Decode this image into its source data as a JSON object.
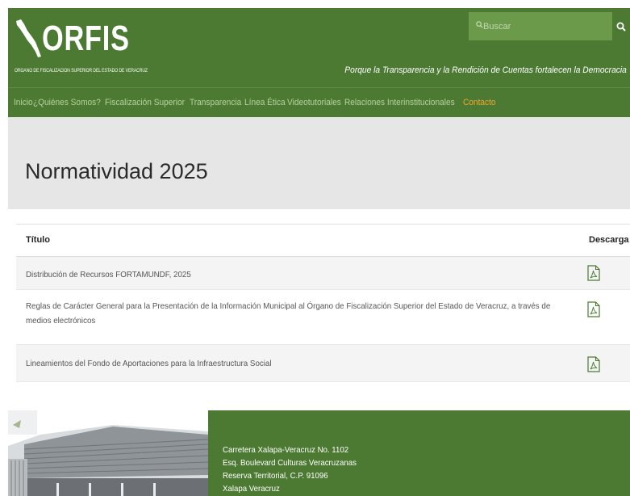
{
  "header": {
    "logo_text": "ORFIS",
    "logo_subtitle": "ÓRGANO DE FISCALIZACIÓN SUPERIOR DEL ESTADO DE VERACRUZ",
    "search_placeholder": "Buscar",
    "tagline": "Porque la Transparencia y la Rendición de Cuentas fortalecen la Democracia",
    "colors": {
      "brand_green": "#4c7a33",
      "search_bg": "#6a9a4a",
      "active_link": "#f0a830"
    }
  },
  "nav": {
    "items": [
      {
        "label": "Inicio",
        "icon": "",
        "active": false
      },
      {
        "label": "¿Quiénes Somos?",
        "active": false
      },
      {
        "label": "Fiscalización Superior",
        "active": false
      },
      {
        "label": "Transparencia",
        "active": false
      },
      {
        "label": "Línea Ética",
        "active": false
      },
      {
        "label": "Videotutoriales",
        "active": false
      },
      {
        "label": "Relaciones Interinstitucionales",
        "active": false
      },
      {
        "label": "Contacto",
        "active": true
      }
    ]
  },
  "page": {
    "title": "Normatividad 2025"
  },
  "table": {
    "headers": {
      "title": "Título",
      "download": "Descarga"
    },
    "rows": [
      {
        "title": "Distribución de Recursos FORTAMUNDF, 2025",
        "icon": "pdf-icon"
      },
      {
        "title": "Reglas de Carácter General para la Presentación de la Información Municipal al Órgano de Fiscalización Superior del Estado de Veracruz, a través de medios electrónicos",
        "icon": "pdf-icon"
      },
      {
        "title": "Lineamientos del Fondo de Aportaciones para la Infraestructura Social",
        "icon": "pdf-icon"
      }
    ]
  },
  "footer": {
    "address": [
      "Carretera Xalapa-Veracruz No. 1102",
      "Esq. Boulevard Culturas Veracruzanas",
      "Reserva Territorial, C.P. 91096",
      "Xalapa Veracruz"
    ]
  }
}
